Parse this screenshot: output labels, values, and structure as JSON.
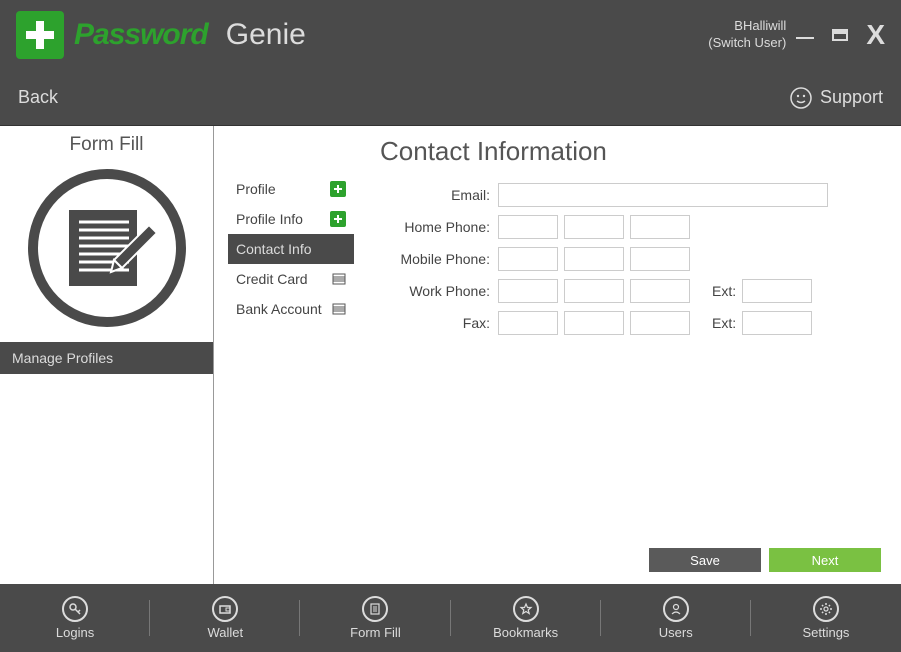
{
  "titlebar": {
    "brand_password": "Password",
    "brand_genie": "Genie",
    "username": "BHalliwill",
    "switch_user": "(Switch User)"
  },
  "navbar": {
    "back": "Back",
    "support": "Support"
  },
  "sidebar": {
    "title": "Form Fill",
    "manage_profiles": "Manage Profiles"
  },
  "subnav": {
    "items": [
      {
        "label": "Profile",
        "icon": "plus",
        "active": false
      },
      {
        "label": "Profile Info",
        "icon": "plus",
        "active": false
      },
      {
        "label": "Contact Info",
        "icon": "none",
        "active": true
      },
      {
        "label": "Credit Card",
        "icon": "card",
        "active": false
      },
      {
        "label": "Bank Account",
        "icon": "card",
        "active": false
      }
    ]
  },
  "form": {
    "title": "Contact Information",
    "labels": {
      "email": "Email:",
      "home_phone": "Home Phone:",
      "mobile_phone": "Mobile Phone:",
      "work_phone": "Work Phone:",
      "fax": "Fax:",
      "ext": "Ext:"
    },
    "values": {
      "email": "",
      "home_phone": [
        "",
        "",
        ""
      ],
      "mobile_phone": [
        "",
        "",
        ""
      ],
      "work_phone": [
        "",
        "",
        ""
      ],
      "work_ext": "",
      "fax": [
        "",
        "",
        ""
      ],
      "fax_ext": ""
    },
    "buttons": {
      "save": "Save",
      "next": "Next"
    }
  },
  "bottombar": {
    "items": [
      {
        "label": "Logins"
      },
      {
        "label": "Wallet"
      },
      {
        "label": "Form Fill"
      },
      {
        "label": "Bookmarks"
      },
      {
        "label": "Users"
      },
      {
        "label": "Settings"
      }
    ]
  }
}
